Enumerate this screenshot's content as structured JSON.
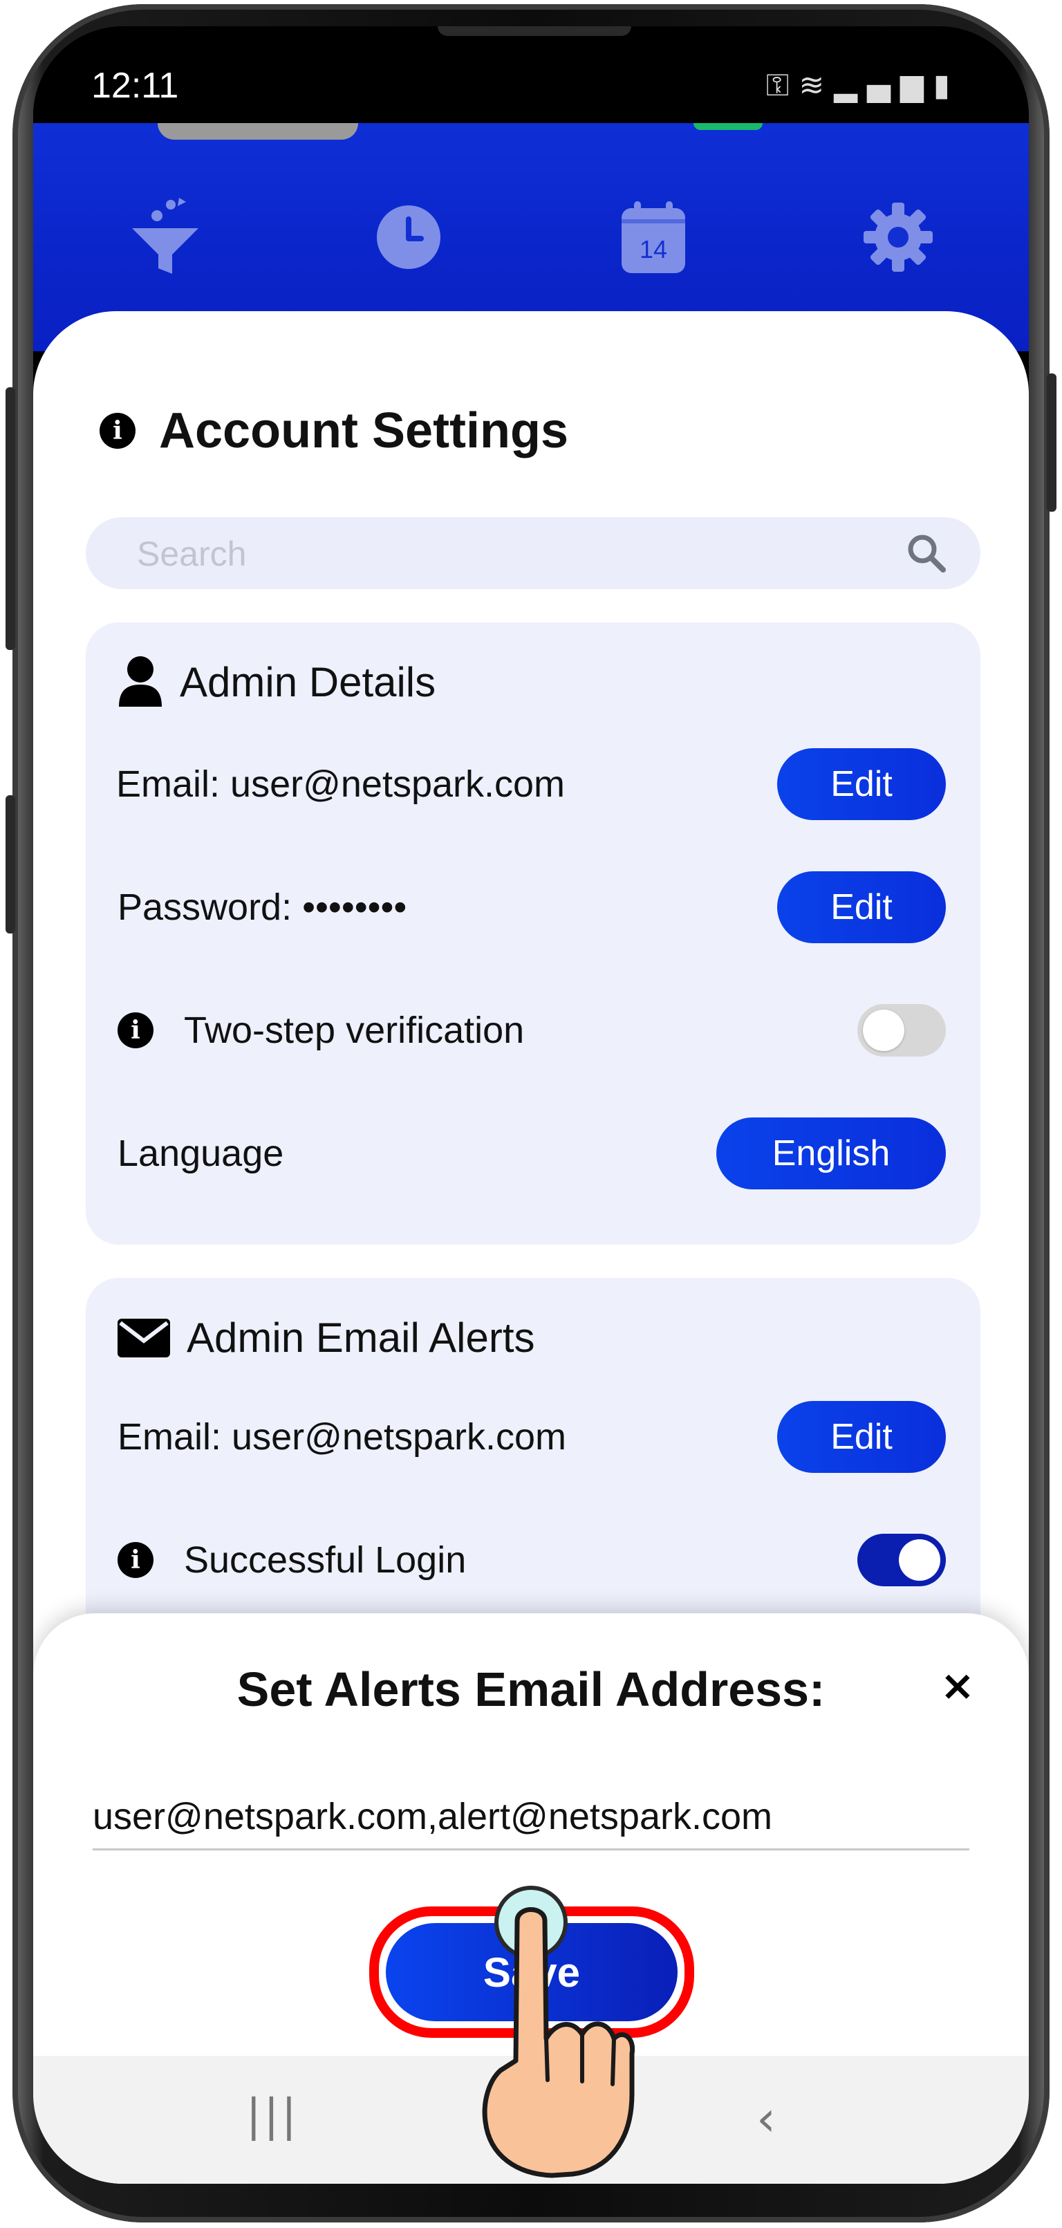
{
  "status_bar": {
    "time": "12:11",
    "icons": [
      "key-icon",
      "wifi-icon",
      "signal-icon",
      "battery-icon"
    ]
  },
  "header": {
    "icons": [
      "filter-icon",
      "clock-icon",
      "calendar-icon",
      "gear-icon"
    ],
    "calendar_day": "14",
    "color": "#0f2fd6"
  },
  "page": {
    "title": "Account Settings"
  },
  "search": {
    "placeholder": "Search"
  },
  "admin_details": {
    "title": "Admin Details",
    "email_label": "Email: user@netspark.com",
    "email_button": "Edit",
    "password_label": "Password: ••••••••",
    "password_button": "Edit",
    "two_step_label": "Two-step verification",
    "two_step_enabled": false,
    "language_label": "Language",
    "language_value": "English"
  },
  "admin_email_alerts": {
    "title": "Admin Email Alerts",
    "email_label": "Email: user@netspark.com",
    "email_button": "Edit",
    "successful_login_label": "Successful Login",
    "successful_login_enabled": true
  },
  "modal": {
    "title": "Set Alerts Email Address:",
    "close_symbol": "×",
    "email_value": "user@netspark.com,alert@netspark.com",
    "save_label": "Save"
  },
  "nav_bar": {
    "icons": [
      "recent-apps-icon",
      "home-icon",
      "back-icon"
    ]
  },
  "colors": {
    "accent": "#0a42ea",
    "highlight": "#ff0000",
    "section_bg": "#eef0fc"
  }
}
